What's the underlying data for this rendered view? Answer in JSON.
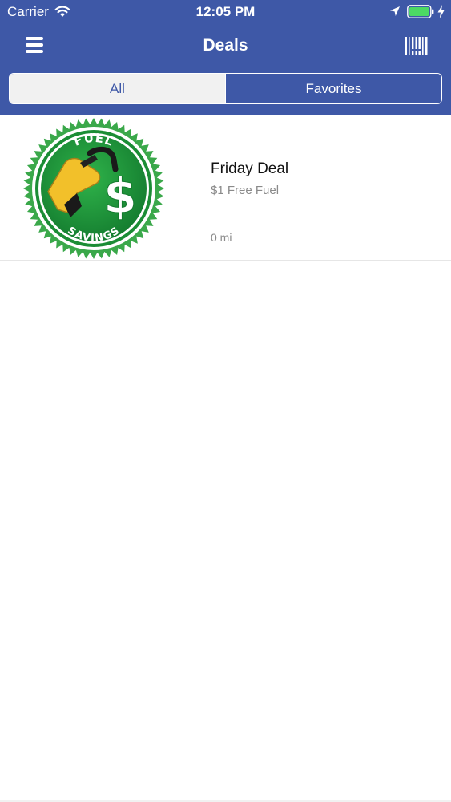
{
  "status_bar": {
    "carrier": "Carrier",
    "time": "12:05 PM",
    "wifi_icon": "wifi-icon",
    "location_icon": "location-arrow-icon",
    "battery_icon": "battery-full-icon",
    "charging_icon": "charging-bolt-icon"
  },
  "nav": {
    "title": "Deals",
    "menu_icon": "hamburger-menu-icon",
    "barcode_icon": "barcode-icon"
  },
  "segments": [
    {
      "label": "All",
      "selected": true
    },
    {
      "label": "Favorites",
      "selected": false
    }
  ],
  "deals": [
    {
      "title": "Friday Deal",
      "subtitle": "$1 Free Fuel",
      "distance": "0 mi",
      "image": {
        "icon": "fuel-savings-badge",
        "top_text": "FUEL",
        "bottom_text": "SAVINGS",
        "symbol": "$"
      }
    }
  ],
  "colors": {
    "brand": "#3e58a7",
    "segment_selected_bg": "#f1f1f1",
    "badge_green": "#1f9a3a",
    "nozzle_yellow": "#f2c02a"
  }
}
